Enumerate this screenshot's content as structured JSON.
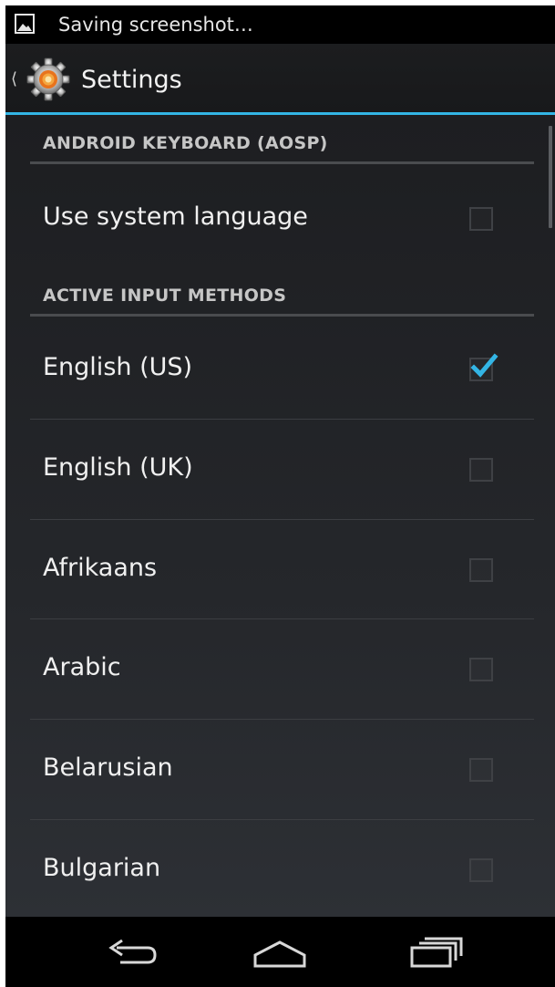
{
  "status_bar": {
    "notification_icon": "image-icon",
    "text": "Saving screenshot…"
  },
  "action_bar": {
    "up_icon": "chevron-left-icon",
    "app_icon": "settings-gear-icon",
    "title": "Settings"
  },
  "sections": [
    {
      "header": "ANDROID KEYBOARD (AOSP)",
      "items": [
        {
          "label": "Use system language",
          "checked": false
        }
      ]
    },
    {
      "header": "ACTIVE INPUT METHODS",
      "items": [
        {
          "label": "English (US)",
          "checked": true
        },
        {
          "label": "English (UK)",
          "checked": false
        },
        {
          "label": "Afrikaans",
          "checked": false
        },
        {
          "label": "Arabic",
          "checked": false
        },
        {
          "label": "Belarusian",
          "checked": false
        },
        {
          "label": "Bulgarian",
          "checked": false
        }
      ]
    }
  ],
  "nav_bar": {
    "back_icon": "back-icon",
    "home_icon": "home-icon",
    "recents_icon": "recent-apps-icon"
  },
  "colors": {
    "accent": "#33b5e5",
    "background": "#1d1e21",
    "text": "#f0f0f0",
    "header_text": "#c6c6c6"
  }
}
